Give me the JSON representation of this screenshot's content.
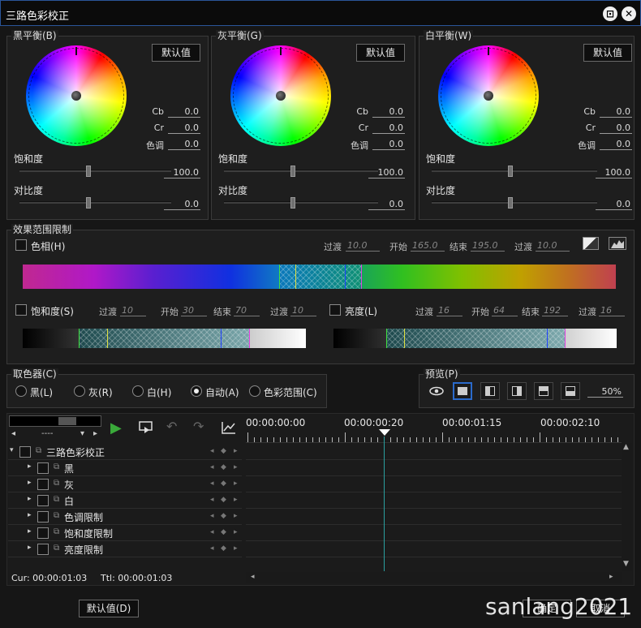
{
  "window": {
    "title": "三路色彩校正"
  },
  "icons": {
    "restore": "restore-icon",
    "close": "close-icon"
  },
  "balance": [
    {
      "label": "黑平衡(B)",
      "default_btn": "默认值",
      "cb_label": "Cb",
      "cb": "0.0",
      "cr_label": "Cr",
      "cr": "0.0",
      "hue_label": "色调",
      "hue": "0.0",
      "sat_label": "饱和度",
      "sat": "100.0",
      "contrast_label": "对比度",
      "contrast": "0.0"
    },
    {
      "label": "灰平衡(G)",
      "default_btn": "默认值",
      "cb_label": "Cb",
      "cb": "0.0",
      "cr_label": "Cr",
      "cr": "0.0",
      "hue_label": "色调",
      "hue": "0.0",
      "sat_label": "饱和度",
      "sat": "100.0",
      "contrast_label": "对比度",
      "contrast": "0.0"
    },
    {
      "label": "白平衡(W)",
      "default_btn": "默认值",
      "cb_label": "Cb",
      "cb": "0.0",
      "cr_label": "Cr",
      "cr": "0.0",
      "hue_label": "色调",
      "hue": "0.0",
      "sat_label": "饱和度",
      "sat": "100.0",
      "contrast_label": "对比度",
      "contrast": "0.0"
    }
  ],
  "range": {
    "label": "效果范围限制",
    "hue": {
      "label": "色相(H)",
      "trans_label": "过渡",
      "trans1": "10.0",
      "start_label": "开始",
      "start": "165.0",
      "end_label": "结束",
      "end": "195.0",
      "trans2": "10.0"
    },
    "sat": {
      "label": "饱和度(S)",
      "trans_label": "过渡",
      "trans1": "10",
      "start_label": "开始",
      "start": "30",
      "end_label": "结束",
      "end": "70",
      "trans2": "10"
    },
    "lum": {
      "label": "亮度(L)",
      "trans_label": "过渡",
      "trans1": "16",
      "start_label": "开始",
      "start": "64",
      "end_label": "结束",
      "end": "192",
      "trans2": "16"
    }
  },
  "picker": {
    "label": "取色器(C)",
    "options": [
      "黑(L)",
      "灰(R)",
      "白(H)",
      "自动(A)",
      "色彩范围(C)"
    ],
    "selected": "自动(A)"
  },
  "preview": {
    "label": "预览(P)",
    "zoom": "50%"
  },
  "timeline": {
    "counter": "----",
    "ticks": [
      "00:00:00:00",
      "00:00:00:20",
      "00:00:01:15",
      "00:00:02:10"
    ],
    "tracks": [
      "三路色彩校正",
      "黑",
      "灰",
      "白",
      "色调限制",
      "饱和度限制",
      "亮度限制"
    ],
    "cur": "Cur: 00:00:01:03",
    "ttl": "Ttl: 00:00:01:03"
  },
  "footer": {
    "default_btn": "默认值(D)",
    "ok_btn": "确定",
    "cancel_btn": "取消"
  },
  "watermark": "sanlang2021"
}
